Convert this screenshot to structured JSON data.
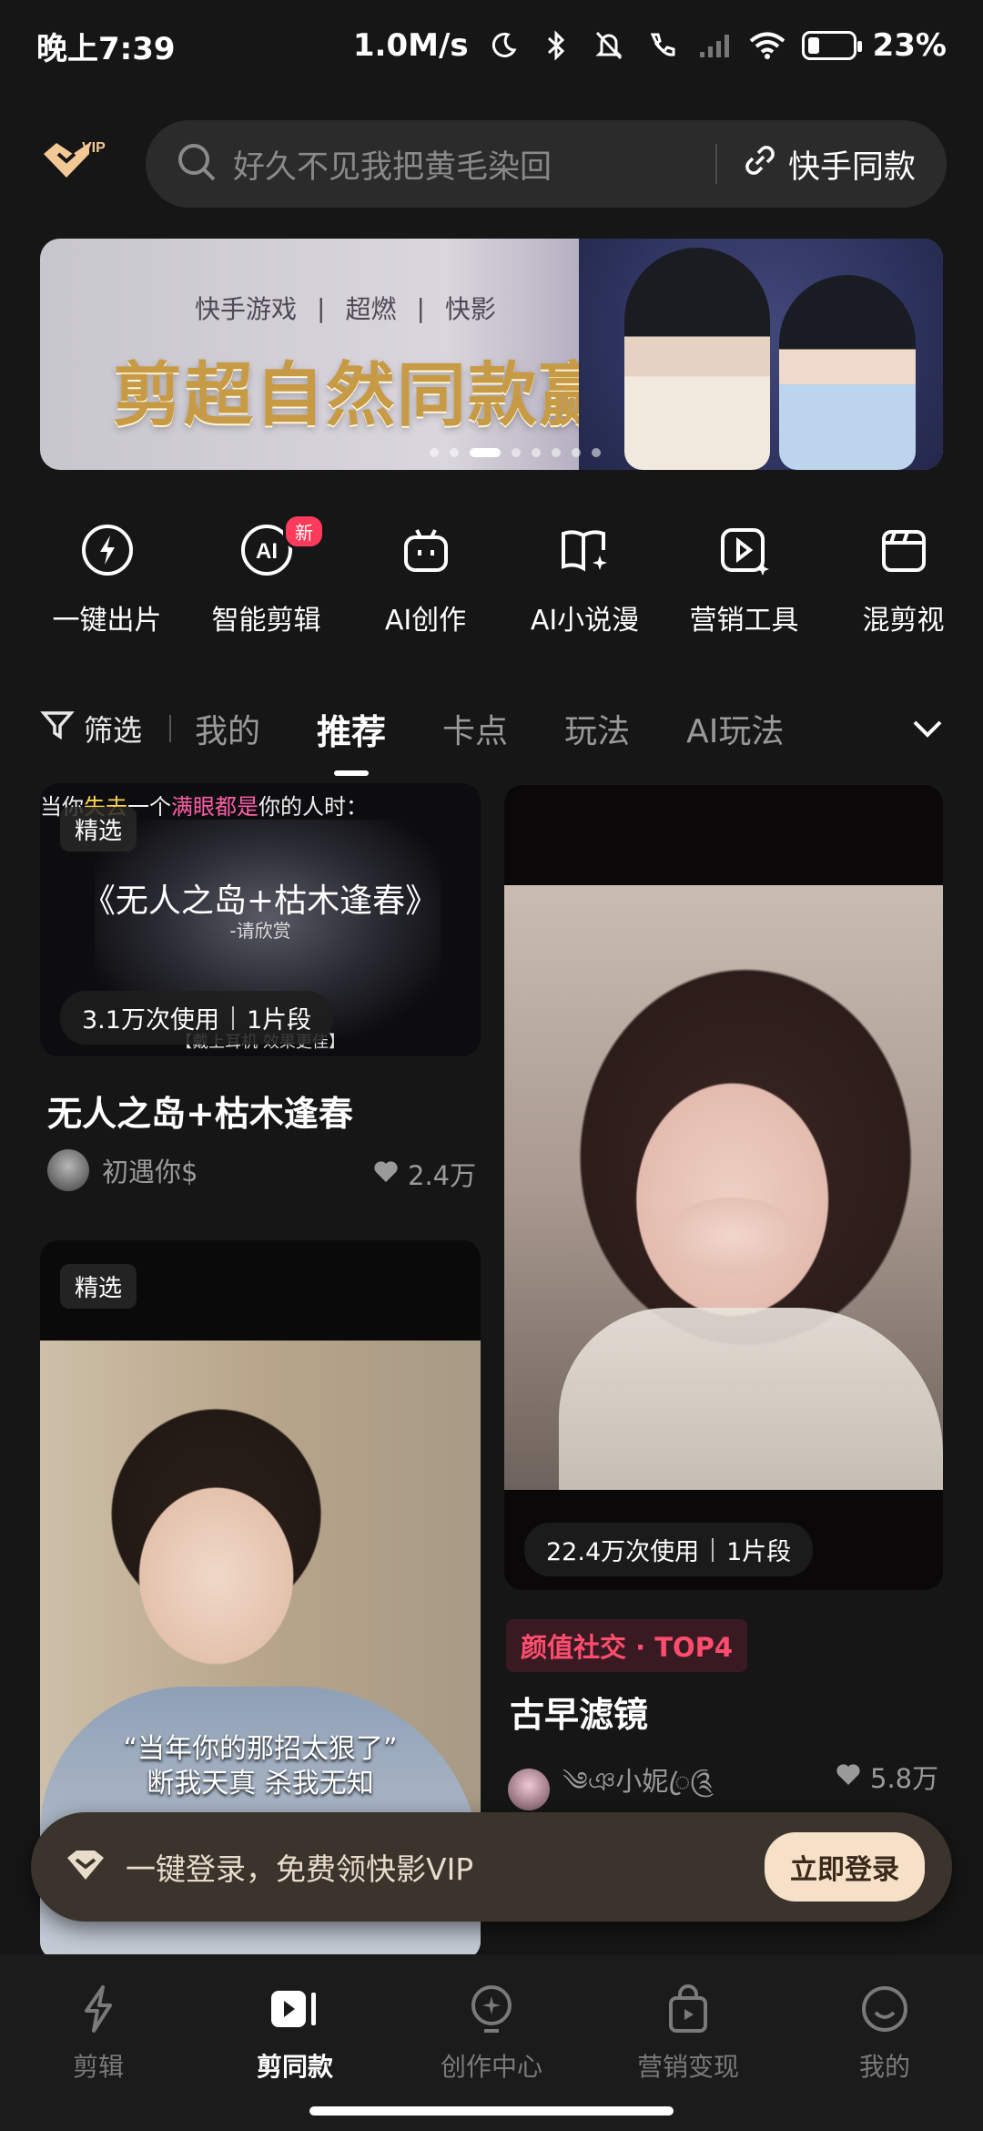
{
  "status_bar": {
    "time": "晚上7:39",
    "network_speed": "1.0M/s",
    "battery": "23%",
    "icons": [
      "moon-icon",
      "bluetooth-icon",
      "mute-bell-icon",
      "call-icon",
      "signal-icon",
      "wifi-icon",
      "battery-icon"
    ]
  },
  "header": {
    "logo_badge": "VIP",
    "search_placeholder": "好久不见我把黄毛染回",
    "same_style_label": "快手同款"
  },
  "banner": {
    "brand_1": "快手游戏",
    "brand_2": "超燃",
    "brand_3": "快影",
    "headline": "剪超自然同款赢现金",
    "page_count": 8,
    "active_page": 3
  },
  "tools": [
    {
      "label": "一键出片",
      "icon": "bolt-icon"
    },
    {
      "label": "智能剪辑",
      "icon": "ai-circle-icon",
      "badge": "新"
    },
    {
      "label": "AI创作",
      "icon": "robot-icon"
    },
    {
      "label": "AI小说漫",
      "icon": "book-sparkle-icon"
    },
    {
      "label": "营销工具",
      "icon": "play-sparkle-icon"
    },
    {
      "label": "混剪视",
      "icon": "clapper-icon"
    }
  ],
  "tabs": {
    "filter_label": "筛选",
    "items": [
      "我的",
      "推荐",
      "卡点",
      "玩法",
      "AI玩法"
    ],
    "active": "推荐"
  },
  "feed": {
    "card_a": {
      "overlay_prefix": "当你",
      "overlay_yellow": "失去",
      "overlay_mid": "一个",
      "overlay_pink": "满眼都是",
      "overlay_suffix": "你的人时：",
      "tag": "精选",
      "song_title": "《无人之岛+枯木逢春》",
      "song_sub": "-请欣赏",
      "hint": "【戴上耳机 效果更佳】",
      "usage": "3.1万次使用",
      "segments": "1片段",
      "title": "无人之岛+枯木逢春",
      "author": "初遇你$",
      "likes": "2.4万"
    },
    "card_b": {
      "usage": "22.4万次使用",
      "segments": "1片段",
      "rank_badge": "颜值社交 · TOP4",
      "title": "古早滤镜",
      "author": "༄ঞ小妮ꦿ༊",
      "likes": "5.8万"
    },
    "card_c": {
      "tag": "精选",
      "caption_1": "“当年你的那招太狠了”",
      "caption_2": "断我天真 杀我无知"
    }
  },
  "login_prompt": {
    "text": "一键登录，免费领快影VIP",
    "button": "立即登录"
  },
  "bottom_nav": [
    {
      "label": "剪辑",
      "icon": "lightning-icon"
    },
    {
      "label": "剪同款",
      "icon": "play-card-icon",
      "active": true
    },
    {
      "label": "创作中心",
      "icon": "bulb-icon"
    },
    {
      "label": "营销变现",
      "icon": "shopping-bag-icon"
    },
    {
      "label": "我的",
      "icon": "smile-icon"
    }
  ]
}
